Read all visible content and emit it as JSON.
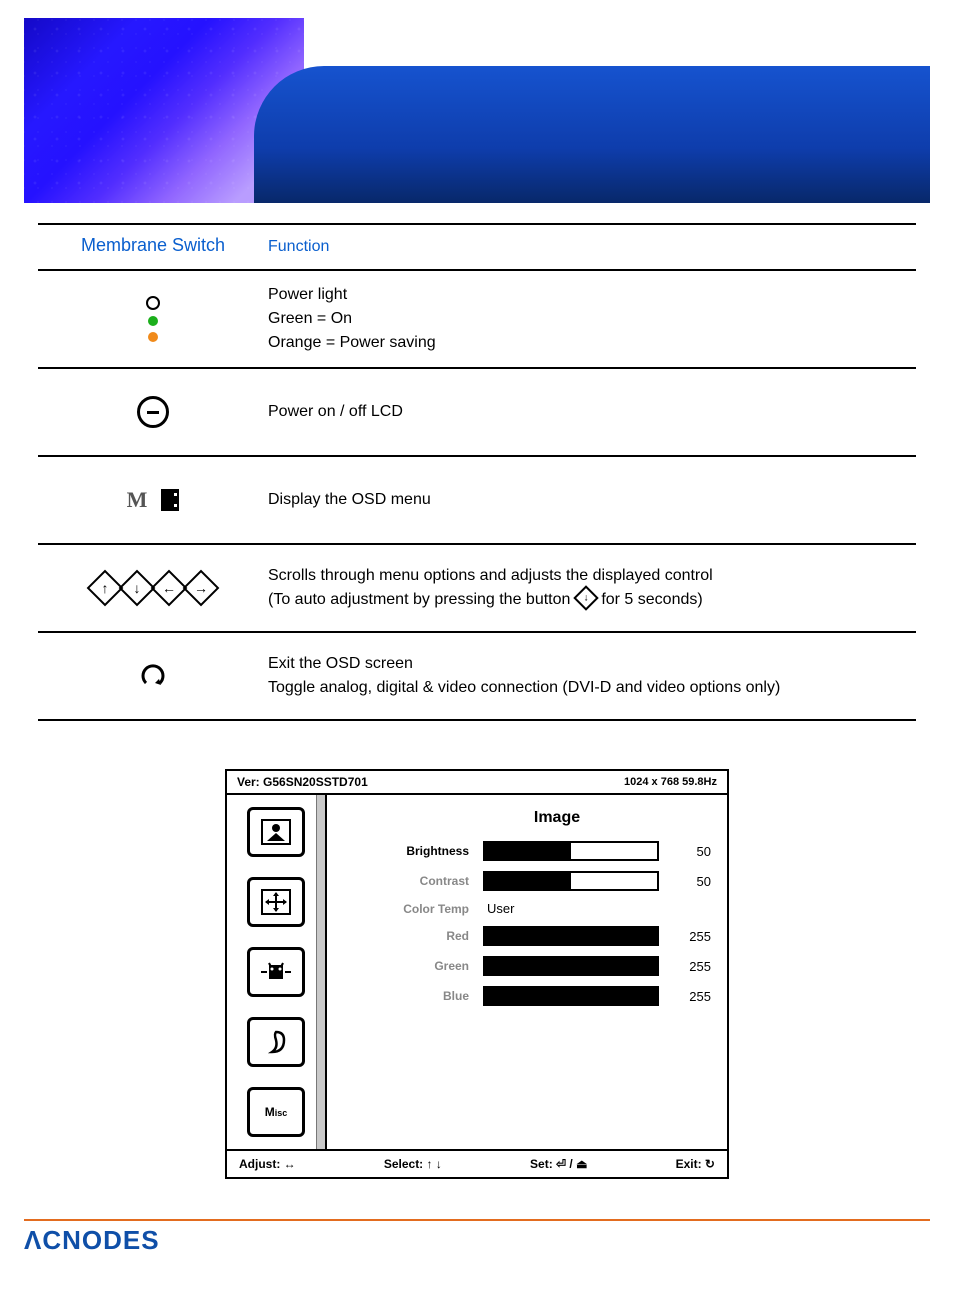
{
  "table": {
    "headers": {
      "switch": "Membrane  Switch",
      "function": "Function"
    },
    "rows": {
      "power_light": {
        "line1": "Power light",
        "line2": "Green = On",
        "line3": "Orange = Power saving"
      },
      "power_btn": {
        "text": "Power on / off LCD"
      },
      "osd_menu": {
        "text": "Display the OSD menu"
      },
      "arrows": {
        "line1": "Scrolls through menu options and adjusts the displayed control",
        "line2a": "(To auto adjustment by pressing the button",
        "line2b": " for 5 seconds)"
      },
      "exit": {
        "line1": "Exit the OSD screen",
        "line2": "Toggle analog, digital & video connection (DVI-D and video options only)"
      }
    }
  },
  "osd": {
    "version": "Ver: G56SN20SSTD701",
    "resolution": "1024 x 768  59.8Hz",
    "heading": "Image",
    "tabs": {
      "image": "image-tab",
      "position": "position-tab",
      "clock": "clock-tab",
      "audio": "audio-tab",
      "misc_label": "Misc"
    },
    "items": {
      "brightness": {
        "label": "Brightness",
        "value": 50,
        "max": 100
      },
      "contrast": {
        "label": "Contrast",
        "value": 50,
        "max": 100
      },
      "color_temp": {
        "label": "Color Temp",
        "value_text": "User"
      },
      "red": {
        "label": "Red",
        "value": 255,
        "max": 255
      },
      "green": {
        "label": "Green",
        "value": 255,
        "max": 255
      },
      "blue": {
        "label": "Blue",
        "value": 255,
        "max": 255
      }
    },
    "footer": {
      "adjust": "Adjust: ↔",
      "select": "Select: ↑ ↓",
      "set": "Set: ⏎ / ⏏",
      "exit": "Exit: ↻"
    }
  },
  "brand": "ACNODES"
}
